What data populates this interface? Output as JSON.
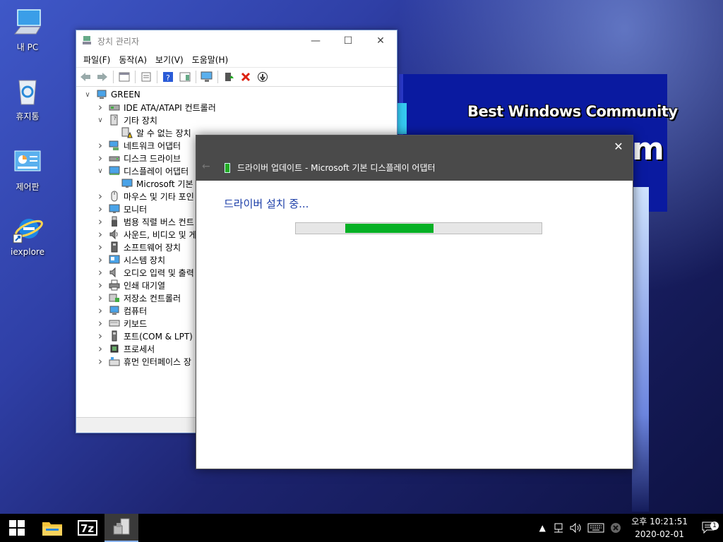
{
  "wallpaper": {
    "tagline": "Best Windows Community",
    "big_text": "m"
  },
  "desktop_icons": [
    {
      "label": "내 PC"
    },
    {
      "label": "휴지통"
    },
    {
      "label": "제어판"
    },
    {
      "label": "iexplore"
    }
  ],
  "device_manager": {
    "title": "장치 관리자",
    "menu": [
      "파일(F)",
      "동작(A)",
      "보기(V)",
      "도움말(H)"
    ],
    "tree": [
      {
        "label": "GREEN",
        "indent": 0,
        "expander": "v",
        "icon": "computer-icon"
      },
      {
        "label": "IDE ATA/ATAPI 컨트롤러",
        "indent": 1,
        "expander": ">",
        "icon": "ide-controller-icon"
      },
      {
        "label": "기타 장치",
        "indent": 1,
        "expander": "v",
        "icon": "other-devices-icon"
      },
      {
        "label": "알 수 없는 장치",
        "indent": 2,
        "expander": "",
        "icon": "warning-device-icon"
      },
      {
        "label": "네트워크 어댑터",
        "indent": 1,
        "expander": ">",
        "icon": "network-adapter-icon"
      },
      {
        "label": "디스크 드라이브",
        "indent": 1,
        "expander": ">",
        "icon": "disk-drive-icon"
      },
      {
        "label": "디스플레이 어댑터",
        "indent": 1,
        "expander": "v",
        "icon": "display-adapter-icon"
      },
      {
        "label": "Microsoft 기본 디",
        "indent": 2,
        "expander": "",
        "icon": "monitor-icon"
      },
      {
        "label": "마우스 및 기타 포인",
        "indent": 1,
        "expander": ">",
        "icon": "mouse-icon"
      },
      {
        "label": "모니터",
        "indent": 1,
        "expander": ">",
        "icon": "monitor-icon"
      },
      {
        "label": "범용 직렬 버스 컨트",
        "indent": 1,
        "expander": ">",
        "icon": "usb-icon"
      },
      {
        "label": "사운드, 비디오 및 게",
        "indent": 1,
        "expander": ">",
        "icon": "sound-icon"
      },
      {
        "label": "소프트웨어 장치",
        "indent": 1,
        "expander": ">",
        "icon": "software-device-icon"
      },
      {
        "label": "시스템 장치",
        "indent": 1,
        "expander": ">",
        "icon": "system-device-icon"
      },
      {
        "label": "오디오 입력 및 출력",
        "indent": 1,
        "expander": ">",
        "icon": "audio-icon"
      },
      {
        "label": "인쇄 대기열",
        "indent": 1,
        "expander": ">",
        "icon": "printer-icon"
      },
      {
        "label": "저장소 컨트롤러",
        "indent": 1,
        "expander": ">",
        "icon": "storage-controller-icon"
      },
      {
        "label": "컴퓨터",
        "indent": 1,
        "expander": ">",
        "icon": "computer-icon"
      },
      {
        "label": "키보드",
        "indent": 1,
        "expander": ">",
        "icon": "keyboard-icon"
      },
      {
        "label": "포트(COM & LPT)",
        "indent": 1,
        "expander": ">",
        "icon": "port-icon"
      },
      {
        "label": "프로세서",
        "indent": 1,
        "expander": ">",
        "icon": "processor-icon"
      },
      {
        "label": "휴먼 인터페이스 장",
        "indent": 1,
        "expander": ">",
        "icon": "hid-icon"
      }
    ]
  },
  "driver_dialog": {
    "title": "드라이버 업데이트 - Microsoft 기본 디스플레이 어댑터",
    "heading": "드라이버 설치 중...",
    "progress_start": 0.2,
    "progress_end": 0.56,
    "progress_color": "#06b025"
  },
  "taskbar": {
    "time": "오후 10:21:51",
    "date": "2020-02-01",
    "notification_count": "1"
  }
}
